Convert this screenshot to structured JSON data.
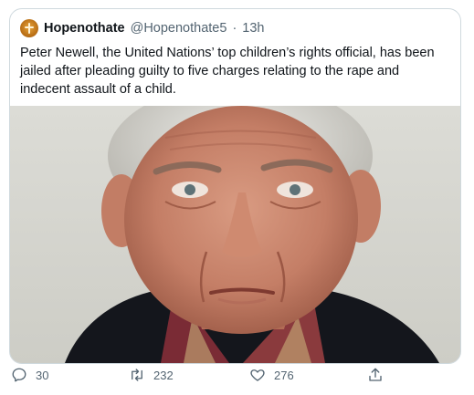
{
  "tweet": {
    "display_name": "Hopenothate",
    "handle": "@Hopenothate5",
    "separator": "·",
    "time": "13h",
    "text": "Peter Newell, the United Nations’ top children’s rights official, has been jailed after pleading guilty to five charges relating to the rape and indecent assault of a child.",
    "avatar_icon": "hope-not-hate-logo",
    "photo_description_icon": "photo"
  },
  "actions": {
    "reply_count": "30",
    "retweet_count": "232",
    "like_count": "276"
  },
  "colors": {
    "text": "#0f1419",
    "muted": "#536471",
    "border": "#cfd9de"
  }
}
